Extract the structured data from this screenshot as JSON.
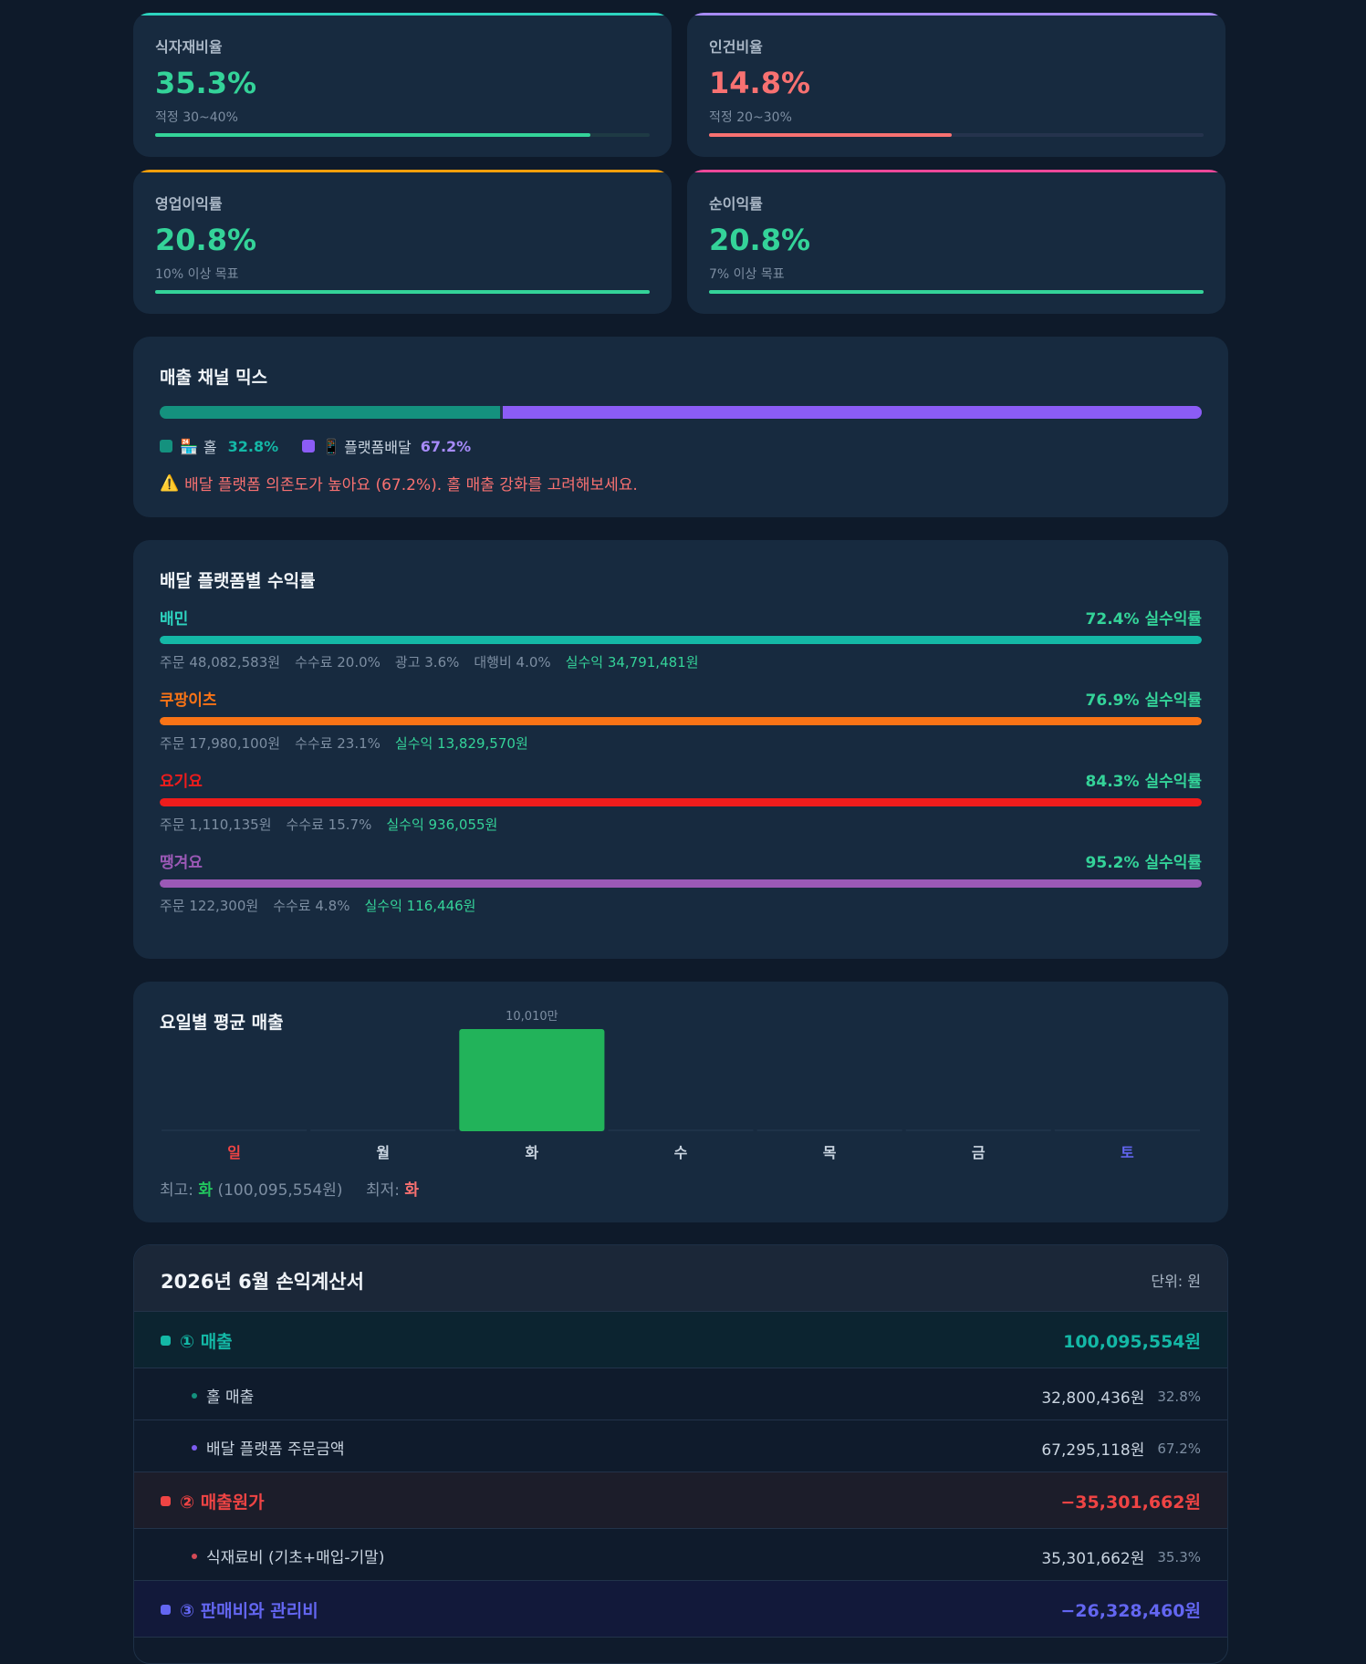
{
  "kpis": [
    {
      "label": "식자재비율",
      "value": "35.3%",
      "note": "적정 30~40%",
      "progress": 0.88,
      "value_color": "#34d399",
      "bar_color": "#34d399",
      "track_color": "#1e3a44"
    },
    {
      "label": "인건비율",
      "value": "14.8%",
      "note": "적정 20~30%",
      "progress": 0.49,
      "value_color": "#f87171",
      "bar_color": "#f87171",
      "track_color": "#25334d"
    },
    {
      "label": "영업이익률",
      "value": "20.8%",
      "note": "10% 이상 목표",
      "progress": 1.0,
      "value_color": "#34d399",
      "bar_color": "#34d399",
      "track_color": "#23384e"
    },
    {
      "label": "순이익률",
      "value": "20.8%",
      "note": "7% 이상 목표",
      "progress": 1.0,
      "value_color": "#34d399",
      "bar_color": "#34d399",
      "track_color": "#23384e"
    }
  ],
  "channel_mix": {
    "title": "매출 채널 믹스",
    "hall": {
      "icon": "🏪",
      "label": "홀",
      "pct": "32.8%",
      "share": 0.328,
      "color": "#14917e"
    },
    "delivery": {
      "icon": "📱",
      "label": "플랫폼배달",
      "pct": "67.2%",
      "share": 0.672,
      "color": "#8b5cf6"
    },
    "warning_icon": "⚠️",
    "warning": "배달 플랫폼 의존도가 높아요 (67.2%). 홀 매출 강화를 고려해보세요."
  },
  "platforms": {
    "title": "배달 플랫폼별 수익률",
    "suffix": "실수익률",
    "items": [
      {
        "name": "배민",
        "rate": "72.4%",
        "color": "#14b8a6",
        "meta": [
          "주문 48,082,583원",
          "수수료 20.0%",
          "광고 3.6%",
          "대행비 4.0%"
        ],
        "net": "실수익 34,791,481원"
      },
      {
        "name": "쿠팡이츠",
        "rate": "76.9%",
        "color": "#f97316",
        "meta": [
          "주문 17,980,100원",
          "수수료 23.1%"
        ],
        "net": "실수익 13,829,570원"
      },
      {
        "name": "요기요",
        "rate": "84.3%",
        "color": "#ef1c1c",
        "meta": [
          "주문 1,110,135원",
          "수수료 15.7%"
        ],
        "net": "실수익 936,055원"
      },
      {
        "name": "땡겨요",
        "rate": "95.2%",
        "color": "#9b59b6",
        "meta": [
          "주문 122,300원",
          "수수료 4.8%"
        ],
        "net": "실수익 116,446원"
      }
    ]
  },
  "weekday": {
    "title": "요일별 평균 매출",
    "days": [
      "일",
      "월",
      "화",
      "수",
      "목",
      "금",
      "토"
    ],
    "day_colors": [
      "#ef4444",
      "#c9d4e0",
      "#c9d4e0",
      "#c9d4e0",
      "#c9d4e0",
      "#c9d4e0",
      "#6366f1"
    ],
    "bar_label": "10,010만",
    "best_label": "최고:",
    "best_day": "화",
    "best_amount": "(100,095,554원)",
    "worst_label": "최저:",
    "worst_day": "화"
  },
  "chart_data": {
    "type": "bar",
    "categories": [
      "일",
      "월",
      "화",
      "수",
      "목",
      "금",
      "토"
    ],
    "values": [
      0,
      0,
      10010,
      0,
      0,
      0,
      0
    ],
    "ylabel": "",
    "bar_color": "#22b35a"
  },
  "income": {
    "title": "2026년 6월 손익계산서",
    "unit": "단위: 원",
    "rows": [
      {
        "type": "main",
        "label": "① 매출",
        "amount": "100,095,554원",
        "color": "#14b8a6",
        "bg": "#0c2430"
      },
      {
        "type": "sub",
        "label": "홀 매출",
        "amount": "32,800,436원",
        "pct": "32.8%",
        "dot": "#14917e"
      },
      {
        "type": "sub",
        "label": "배달 플랫폼 주문금액",
        "amount": "67,295,118원",
        "pct": "67.2%",
        "dot": "#7c5cf0"
      },
      {
        "type": "main",
        "label": "② 매출원가",
        "amount": "−35,301,662원",
        "color": "#ef4444",
        "bg": "#1c1d2a"
      },
      {
        "type": "sub",
        "label": "식재료비 (기초+매입-기말)",
        "amount": "35,301,662원",
        "pct": "35.3%",
        "dot": "#d34a56"
      },
      {
        "type": "main",
        "label": "③ 판매비와 관리비",
        "amount": "−26,328,460원",
        "color": "#6366f1",
        "bg": "#12193a"
      }
    ]
  }
}
